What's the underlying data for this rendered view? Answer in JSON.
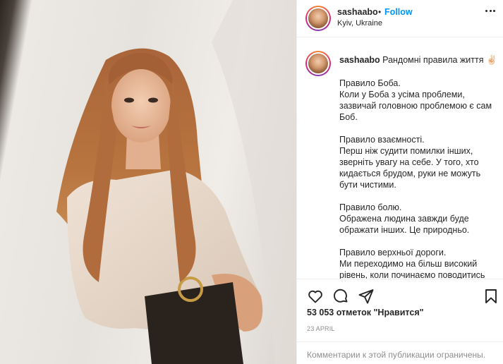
{
  "post": {
    "username": "sashaabo",
    "follow_label": "Follow",
    "location": "Kyiv, Ukraine",
    "caption_title": "Рандомні правила життя ✌🏻",
    "caption_paragraphs": [
      "Правило Боба.\nКоли у Боба з усіма проблеми, зазвичай головною проблемою є сам Боб.",
      "Правило взаємності.\nПерш ніж судити помилки інших, зверніть увагу на себе. У того, хто кидається брудом, руки не можуть бути чистими.",
      "Правило болю.\nОбражена людина завжди буде ображати інших. Це природньо.",
      "Правило верхньої дороги.\nМи переходимо на більш високий рівень, коли починаємо поводитись"
    ],
    "likes": "53 053 отметок \"Нравится\"",
    "date": "23 APRIL",
    "comments_restricted": "Комментарии к этой публикации ограничены."
  },
  "icons": {
    "like": "heart-icon",
    "comment": "comment-icon",
    "share": "share-icon",
    "save": "bookmark-icon",
    "more": "more-icon"
  },
  "colors": {
    "follow": "#0095f6",
    "text": "#262626",
    "muted": "#8e8e8e",
    "border": "#efefef"
  }
}
